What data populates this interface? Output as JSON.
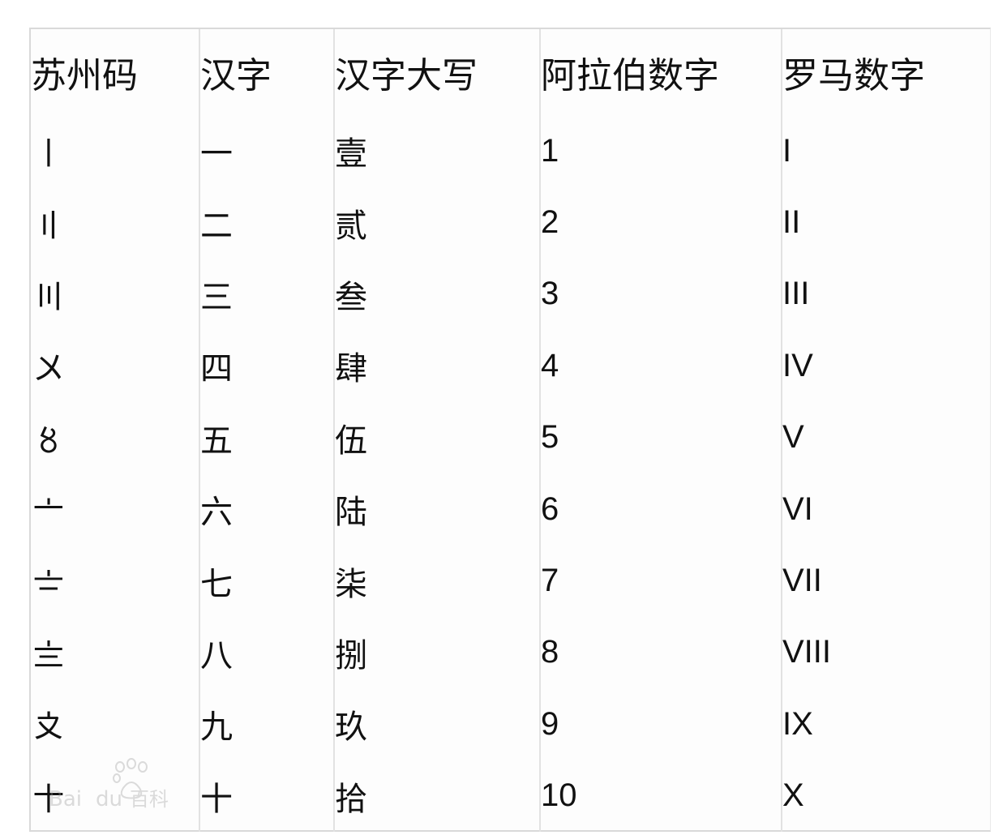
{
  "table": {
    "headers": [
      "苏州码",
      "汉字",
      "汉字大写",
      "阿拉伯数字",
      "罗马数字"
    ],
    "rows": [
      [
        "〡",
        "一",
        "壹",
        "1",
        "I"
      ],
      [
        "〢",
        "二",
        "贰",
        "2",
        "II"
      ],
      [
        "〣",
        "三",
        "叁",
        "3",
        "III"
      ],
      [
        "〤",
        "四",
        "肆",
        "4",
        "IV"
      ],
      [
        "〥",
        "五",
        "伍",
        "5",
        "V"
      ],
      [
        "〦",
        "六",
        "陆",
        "6",
        "VI"
      ],
      [
        "〧",
        "七",
        "柒",
        "7",
        "VII"
      ],
      [
        "〨",
        "八",
        "捌",
        "8",
        "VIII"
      ],
      [
        "〩",
        "九",
        "玖",
        "9",
        "IX"
      ],
      [
        "〸",
        "十",
        "拾",
        "10",
        "X"
      ]
    ]
  },
  "watermark": {
    "icon": "baidu-baike-logo",
    "text": "Baidu百科"
  }
}
